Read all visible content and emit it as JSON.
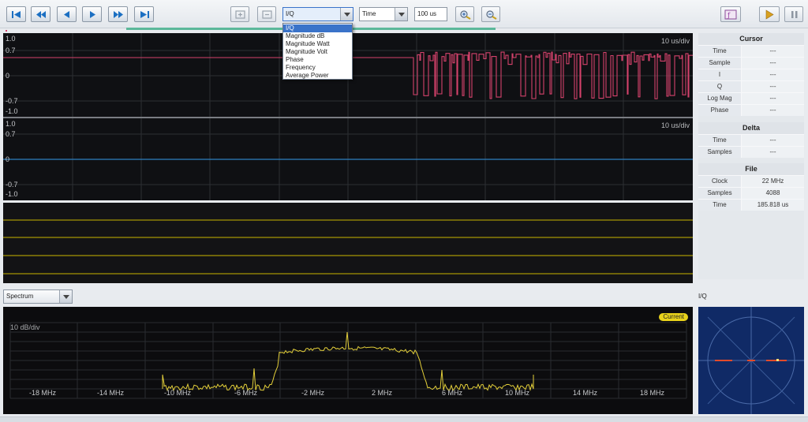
{
  "toolbar": {
    "first_icon": "skip-to-start-icon",
    "rewind_icon": "fast-rewind-icon",
    "prev_icon": "step-back-icon",
    "play_icon": "play-icon",
    "ffwd_icon": "fast-forward-icon",
    "last_icon": "skip-to-end-icon",
    "view_select_value": "I/Q",
    "axis_select_value": "Time",
    "timespan_value": "100 us",
    "accent": "#1b6fc2"
  },
  "view_menu": {
    "options": [
      "I/Q",
      "Magnitude dB",
      "Magnitude Watt",
      "Magnitude Volt",
      "Phase",
      "Frequency",
      "Average Power"
    ],
    "selected": "I/Q"
  },
  "waveform_top": {
    "div_label": "10 us/div",
    "y_ticks": [
      "1.0",
      "0.7",
      "0",
      "-0.7",
      "-1.0"
    ],
    "trace_color": "#d4426b"
  },
  "waveform_bottom": {
    "div_label": "10 us/div",
    "y_ticks": [
      "1.0",
      "0.7",
      "0",
      "-0.7",
      "-1.0"
    ],
    "trace_color": "#2d7fc0"
  },
  "digital_lines_color": "#c8b400",
  "side_panel": {
    "cursor": {
      "title": "Cursor",
      "rows": [
        {
          "k": "Time",
          "v": "---"
        },
        {
          "k": "Sample",
          "v": "---"
        },
        {
          "k": "I",
          "v": "---"
        },
        {
          "k": "Q",
          "v": "---"
        },
        {
          "k": "Log Mag",
          "v": "---"
        },
        {
          "k": "Phase",
          "v": "---"
        }
      ]
    },
    "delta": {
      "title": "Delta",
      "rows": [
        {
          "k": "Time",
          "v": "---"
        },
        {
          "k": "Samples",
          "v": "---"
        }
      ]
    },
    "file": {
      "title": "File",
      "rows": [
        {
          "k": "Clock",
          "v": "22 MHz"
        },
        {
          "k": "Samples",
          "v": "4088"
        },
        {
          "k": "Time",
          "v": "185.818 us"
        }
      ]
    }
  },
  "spectrum": {
    "select_value": "Spectrum",
    "scale_label": "10 dB/div",
    "current_badge": "Current",
    "badge_color": "#e8d21b",
    "trace_color": "#e3cf3a",
    "x_ticks": [
      "-18 MHz",
      "-14 MHz",
      "-10 MHz",
      "-6 MHz",
      "-2 MHz",
      "2 MHz",
      "6 MHz",
      "10 MHz",
      "14 MHz",
      "18 MHz"
    ]
  },
  "constellation": {
    "label": "I/Q",
    "bg_color": "#102a66"
  }
}
